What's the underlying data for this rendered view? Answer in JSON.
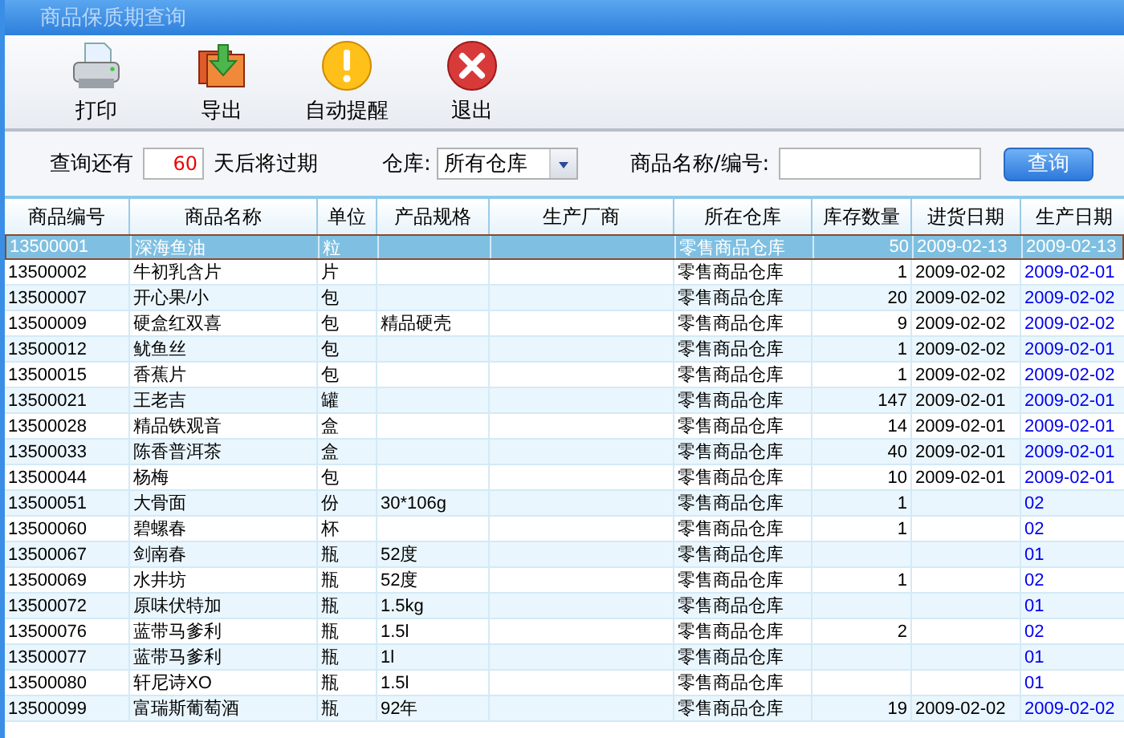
{
  "window": {
    "title": "商品保质期查询"
  },
  "toolbar": [
    {
      "kind": "print",
      "label": "打印"
    },
    {
      "kind": "export",
      "label": "导出"
    },
    {
      "kind": "alert",
      "label": "自动提醒"
    },
    {
      "kind": "exit",
      "label": "退出"
    }
  ],
  "filter": {
    "days_prefix": "查询还有",
    "days_value": "60",
    "days_suffix": "天后将过期",
    "warehouse_label": "仓库:",
    "warehouse_value": "所有仓库",
    "search_label": "商品名称/编号:",
    "search_button": "查询"
  },
  "table": {
    "columns": [
      "商品编号",
      "商品名称",
      "单位",
      "产品规格",
      "生产厂商",
      "所在仓库",
      "库存数量",
      "进货日期",
      "生产日期"
    ],
    "rows": [
      {
        "selected": true,
        "cells": [
          "13500001",
          "深海鱼油",
          "粒",
          "",
          "",
          "零售商品仓库",
          "50",
          "2009-02-13",
          "2009-02-13"
        ]
      },
      {
        "selected": false,
        "cells": [
          "13500002",
          "牛初乳含片",
          "片",
          "",
          "",
          "零售商品仓库",
          "1",
          "2009-02-02",
          "2009-02-01"
        ]
      },
      {
        "selected": false,
        "cells": [
          "13500007",
          "开心果/小",
          "包",
          "",
          "",
          "零售商品仓库",
          "20",
          "2009-02-02",
          "2009-02-02"
        ]
      },
      {
        "selected": false,
        "cells": [
          "13500009",
          "硬盒红双喜",
          "包",
          "精品硬壳",
          "",
          "零售商品仓库",
          "9",
          "2009-02-02",
          "2009-02-02"
        ]
      },
      {
        "selected": false,
        "cells": [
          "13500012",
          "鱿鱼丝",
          "包",
          "",
          "",
          "零售商品仓库",
          "1",
          "2009-02-02",
          "2009-02-01"
        ]
      },
      {
        "selected": false,
        "cells": [
          "13500015",
          "香蕉片",
          "包",
          "",
          "",
          "零售商品仓库",
          "1",
          "2009-02-02",
          "2009-02-02"
        ]
      },
      {
        "selected": false,
        "cells": [
          "13500021",
          "王老吉",
          "罐",
          "",
          "",
          "零售商品仓库",
          "147",
          "2009-02-01",
          "2009-02-01"
        ]
      },
      {
        "selected": false,
        "cells": [
          "13500028",
          "精品铁观音",
          "盒",
          "",
          "",
          "零售商品仓库",
          "14",
          "2009-02-01",
          "2009-02-01"
        ]
      },
      {
        "selected": false,
        "cells": [
          "13500033",
          "陈香普洱茶",
          "盒",
          "",
          "",
          "零售商品仓库",
          "40",
          "2009-02-01",
          "2009-02-01"
        ]
      },
      {
        "selected": false,
        "cells": [
          "13500044",
          "杨梅",
          "包",
          "",
          "",
          "零售商品仓库",
          "10",
          "2009-02-01",
          "2009-02-01"
        ]
      },
      {
        "selected": false,
        "cells": [
          "13500051",
          "大骨面",
          "份",
          "30*106g",
          "",
          "零售商品仓库",
          "1",
          "",
          "02"
        ]
      },
      {
        "selected": false,
        "cells": [
          "13500060",
          "碧螺春",
          "杯",
          "",
          "",
          "零售商品仓库",
          "1",
          "",
          "02"
        ]
      },
      {
        "selected": false,
        "cells": [
          "13500067",
          "剑南春",
          "瓶",
          "52度",
          "",
          "零售商品仓库",
          "",
          "",
          "01"
        ]
      },
      {
        "selected": false,
        "cells": [
          "13500069",
          "水井坊",
          "瓶",
          "52度",
          "",
          "零售商品仓库",
          "1",
          "",
          "02"
        ]
      },
      {
        "selected": false,
        "cells": [
          "13500072",
          "原味伏特加",
          "瓶",
          "1.5kg",
          "",
          "零售商品仓库",
          "",
          "",
          "01"
        ]
      },
      {
        "selected": false,
        "cells": [
          "13500076",
          "蓝带马爹利",
          "瓶",
          "1.5l",
          "",
          "零售商品仓库",
          "2",
          "",
          "02"
        ]
      },
      {
        "selected": false,
        "cells": [
          "13500077",
          "蓝带马爹利",
          "瓶",
          "1l",
          "",
          "零售商品仓库",
          "",
          "",
          "01"
        ]
      },
      {
        "selected": false,
        "cells": [
          "13500080",
          "轩尼诗XO",
          "瓶",
          "1.5l",
          "",
          "零售商品仓库",
          "",
          "",
          "01"
        ]
      },
      {
        "selected": false,
        "cells": [
          "13500099",
          "富瑞斯葡萄酒",
          "瓶",
          "92年",
          "",
          "零售商品仓库",
          "19",
          "2009-02-02",
          "2009-02-02"
        ]
      }
    ]
  }
}
